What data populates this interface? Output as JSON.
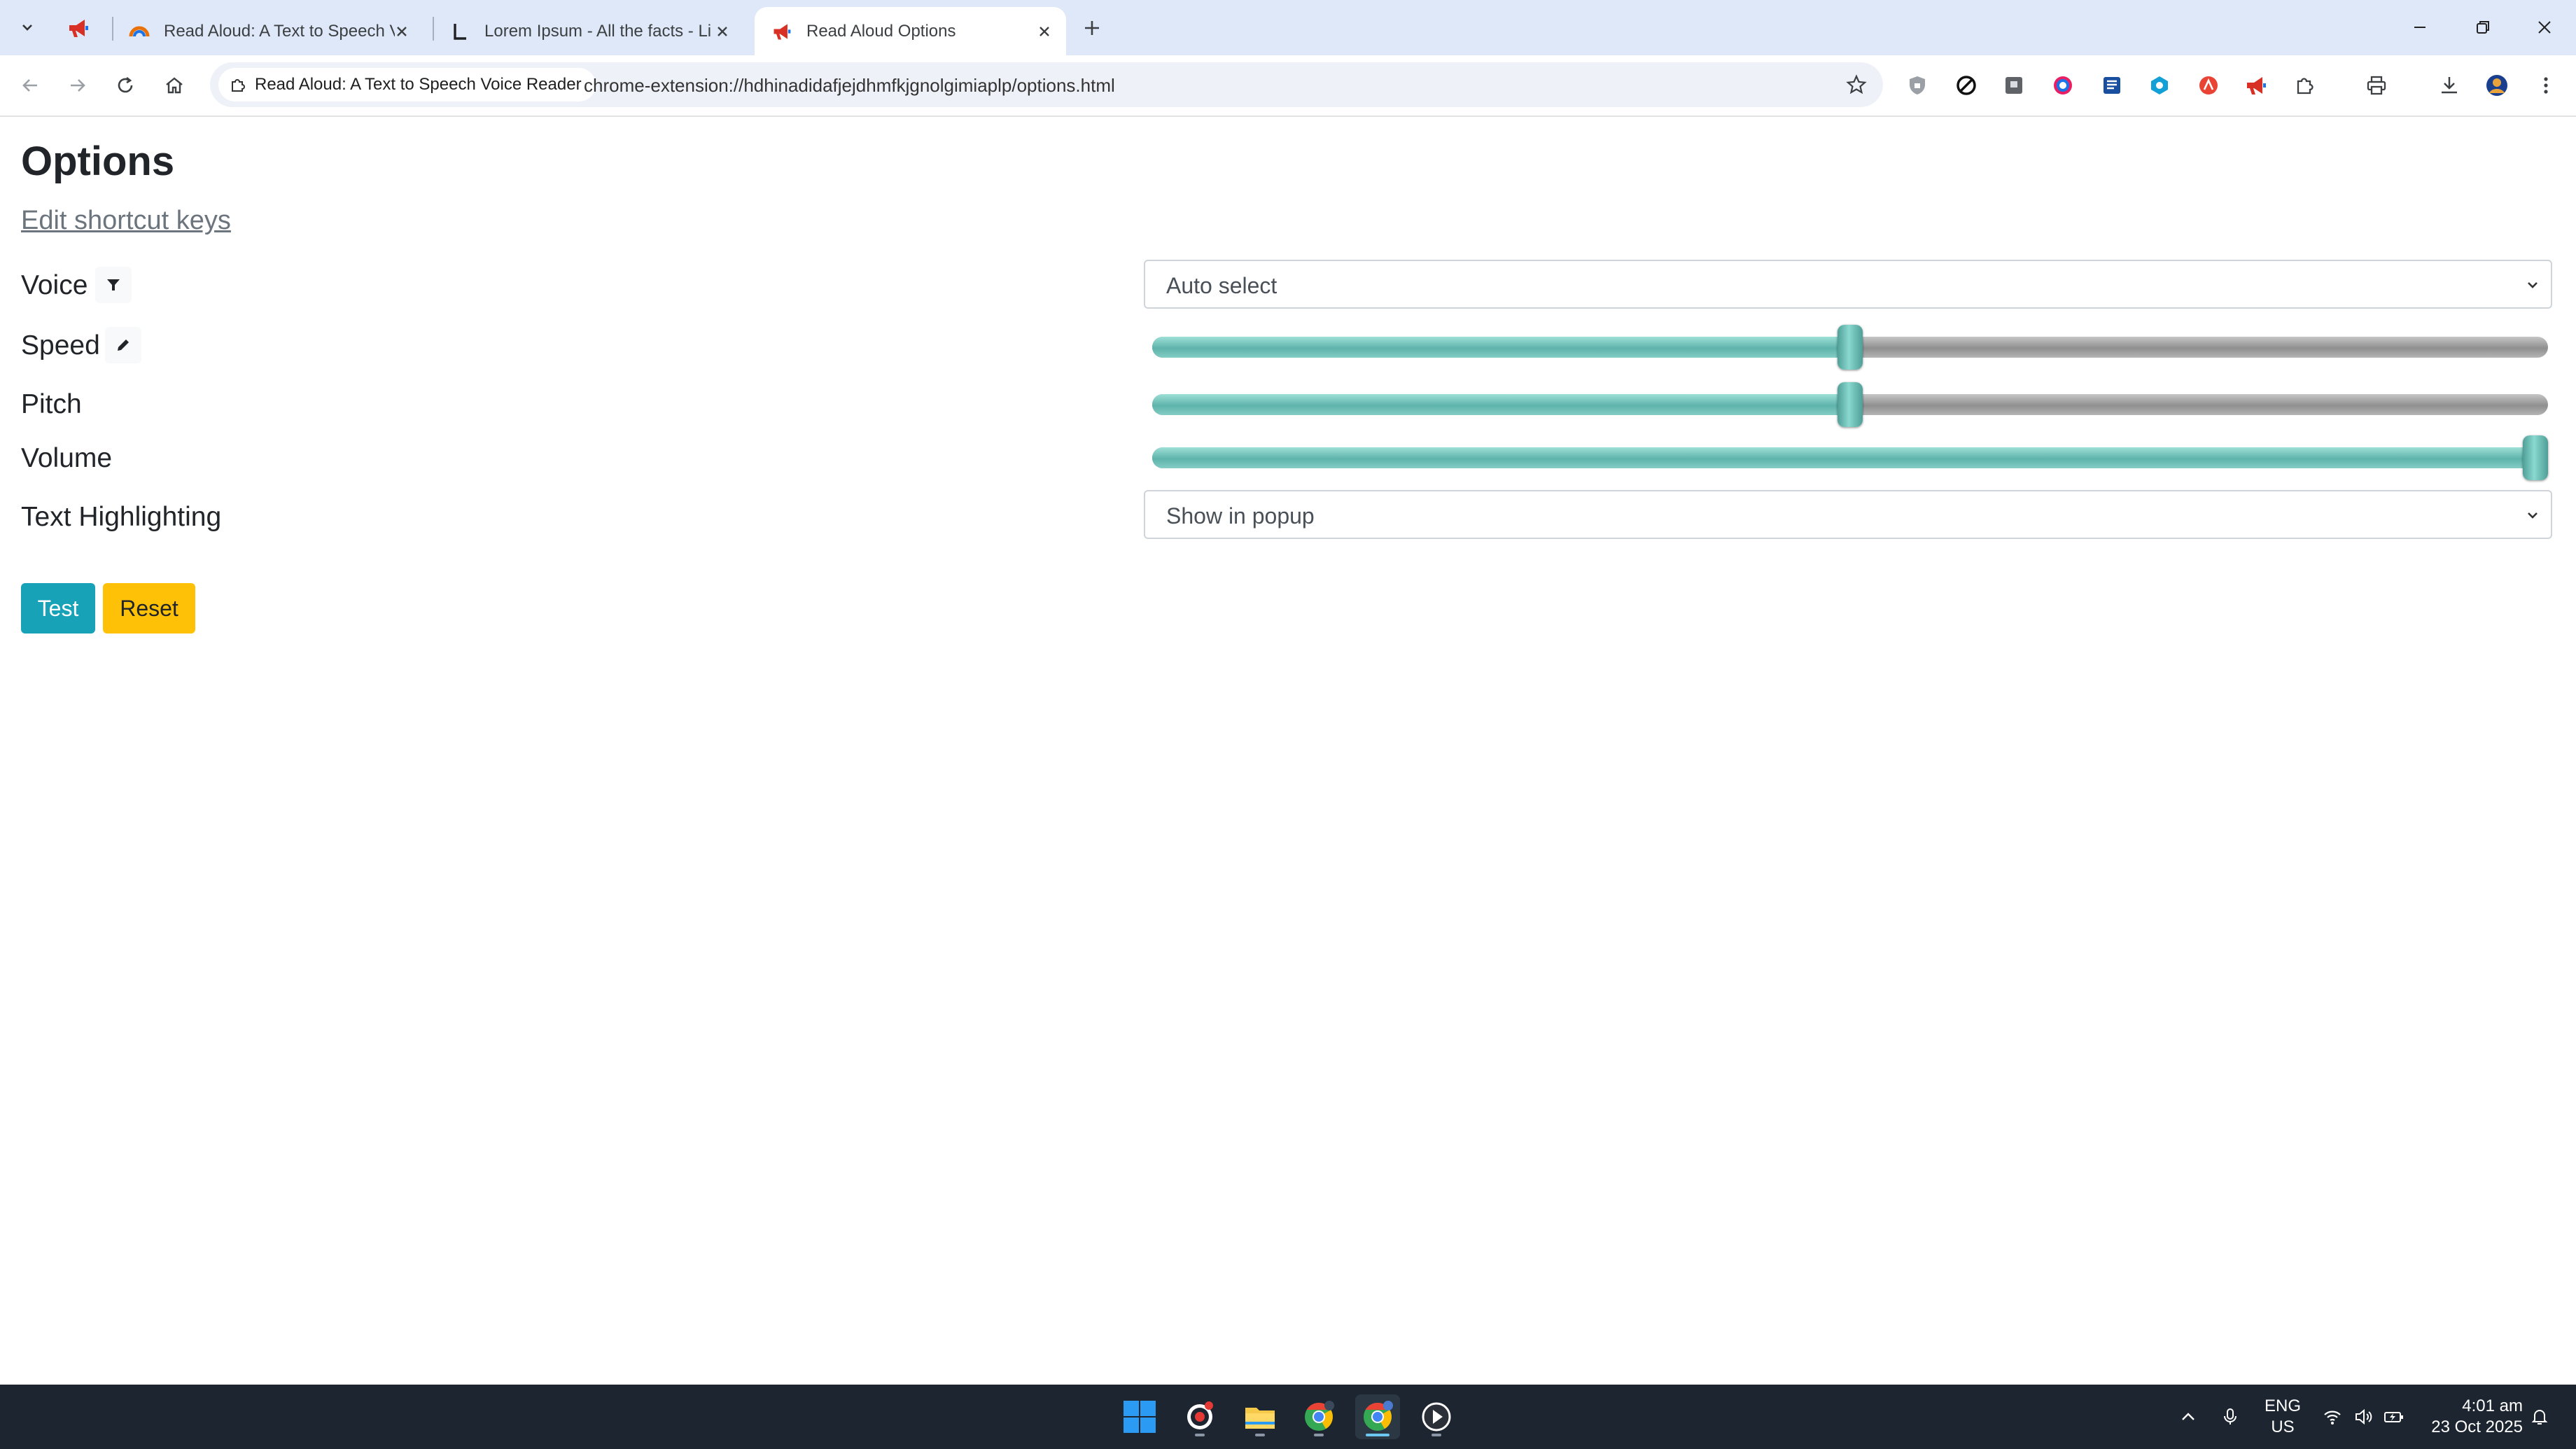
{
  "browser": {
    "tabs": [
      {
        "title": "Read Aloud: A Text to Speech V",
        "icon": "read-aloud-rainbow-icon",
        "active": false
      },
      {
        "title": "Lorem Ipsum - All the facts - Li",
        "icon": "lipsum-logo-icon",
        "active": false
      },
      {
        "title": "Read Aloud Options",
        "icon": "megaphone-icon",
        "active": true
      }
    ],
    "site_chip": "Read Aloud: A Text to Speech Voice Reader",
    "url": "chrome-extension://hdhinadidafjejdhmfkjgnolgimiaplp/options.html"
  },
  "page": {
    "title": "Options",
    "edit_shortcuts": "Edit shortcut keys",
    "labels": {
      "voice": "Voice",
      "speed": "Speed",
      "pitch": "Pitch",
      "volume": "Volume",
      "highlighting": "Text Highlighting"
    },
    "voice_select": "Auto select",
    "highlight_select": "Show in popup",
    "sliders": {
      "speed": 0.5,
      "pitch": 0.5,
      "volume": 1.0
    },
    "buttons": {
      "test": "Test",
      "reset": "Reset"
    }
  },
  "taskbar": {
    "lang_top": "ENG",
    "lang_bottom": "US",
    "time": "4:01 am",
    "date": "23 Oct 2025"
  },
  "colors": {
    "slider_fill": "#5eb3ab",
    "test_button": "#17a2b8",
    "reset_button": "#ffc107",
    "tabstrip": "#dfe8f8",
    "taskbar": "#1c2530"
  }
}
